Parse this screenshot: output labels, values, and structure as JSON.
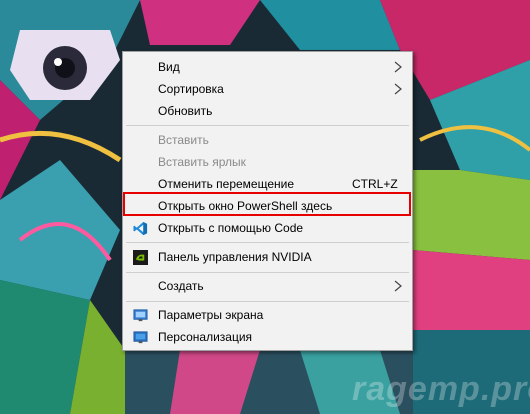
{
  "menu": {
    "items": [
      {
        "label": "Вид",
        "submenu": true
      },
      {
        "label": "Сортировка",
        "submenu": true
      },
      {
        "label": "Обновить"
      },
      {
        "label": "Вставить",
        "disabled": true
      },
      {
        "label": "Вставить ярлык",
        "disabled": true
      },
      {
        "label": "Отменить перемещение",
        "shortcut": "CTRL+Z"
      },
      {
        "label": "Открыть окно PowerShell здесь",
        "highlighted": true
      },
      {
        "label": "Открыть с помощью Code",
        "icon": "vscode-icon"
      },
      {
        "label": "Панель управления NVIDIA",
        "icon": "nvidia-icon"
      },
      {
        "label": "Создать",
        "submenu": true
      },
      {
        "label": "Параметры экрана",
        "icon": "display-settings-icon"
      },
      {
        "label": "Персонализация",
        "icon": "personalization-icon"
      }
    ]
  },
  "highlight_color": "#e60000",
  "watermark": "ragemp.pro"
}
